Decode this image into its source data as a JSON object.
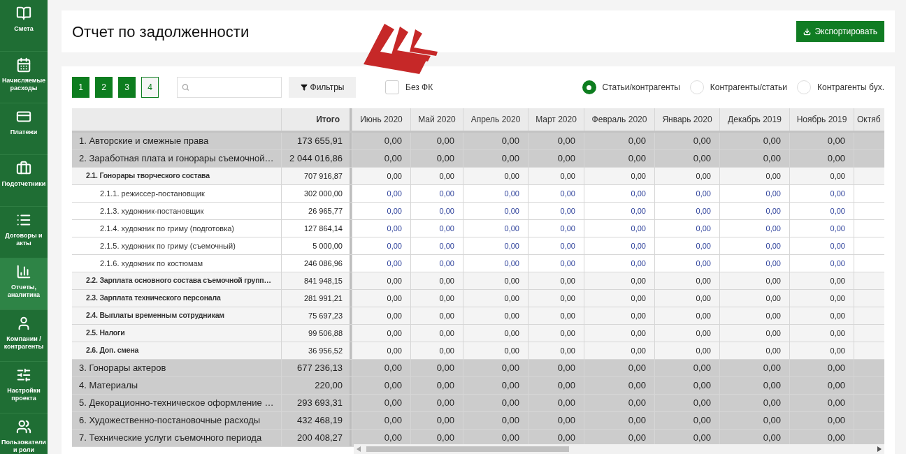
{
  "sidebar": {
    "items": [
      {
        "label": "Смета",
        "selected": false
      },
      {
        "label": "Начисляемые расходы",
        "selected": false
      },
      {
        "label": "Платежи",
        "selected": false
      },
      {
        "label": "Подотчетники",
        "selected": false
      },
      {
        "label": "Договоры и акты",
        "selected": false
      },
      {
        "label": "Отчеты, аналитика",
        "selected": true
      },
      {
        "label": "Компании / контрагенты",
        "selected": false
      },
      {
        "label": "Настройки проекта",
        "selected": false
      },
      {
        "label": "Пользователи и роли",
        "selected": false
      }
    ]
  },
  "header": {
    "title": "Отчет по задолженности",
    "export_button": "Экспортировать"
  },
  "toolbar": {
    "levels": [
      {
        "label": "1",
        "filled": true
      },
      {
        "label": "2",
        "filled": true
      },
      {
        "label": "3",
        "filled": true
      },
      {
        "label": "4",
        "filled": false
      }
    ],
    "filters_button": "Фильтры",
    "checkbox": {
      "label": "Без ФК",
      "checked": false
    },
    "views": [
      {
        "label": "Статьи/контрагенты",
        "selected": true
      },
      {
        "label": "Контрагенты/статьи",
        "selected": false
      },
      {
        "label": "Контрагенты бух.",
        "selected": false
      }
    ]
  },
  "table": {
    "columns": [
      "Итого",
      "Июнь 2020",
      "Май 2020",
      "Апрель 2020",
      "Март 2020",
      "Февраль 2020",
      "Январь 2020",
      "Декабрь 2019",
      "Ноябрь 2019",
      "Октяб"
    ],
    "rows": [
      {
        "label": "1. Авторские и смежные права",
        "total": "173 655,91",
        "values": [
          "0,00",
          "0,00",
          "0,00",
          "0,00",
          "0,00",
          "0,00",
          "0,00",
          "0,00"
        ]
      },
      {
        "label": "2. Заработная плата и гонорары съемочной…",
        "total": "2 044 016,86",
        "values": [
          "0,00",
          "0,00",
          "0,00",
          "0,00",
          "0,00",
          "0,00",
          "0,00",
          "0,00"
        ],
        "children": [
          {
            "label": "2.1. Гонорары творческого состава",
            "total": "707 916,87",
            "values": [
              "0,00",
              "0,00",
              "0,00",
              "0,00",
              "0,00",
              "0,00",
              "0,00",
              "0,00"
            ],
            "children": [
              {
                "label": "2.1.1. режиссер-постановщик",
                "total": "302 000,00",
                "values": [
                  "0,00",
                  "0,00",
                  "0,00",
                  "0,00",
                  "0,00",
                  "0,00",
                  "0,00",
                  "0,00"
                ]
              },
              {
                "label": "2.1.3. художник-постановщик",
                "total": "26 965,77",
                "values": [
                  "0,00",
                  "0,00",
                  "0,00",
                  "0,00",
                  "0,00",
                  "0,00",
                  "0,00",
                  "0,00"
                ]
              },
              {
                "label": "2.1.4. художник по гриму (подготовка)",
                "total": "127 864,14",
                "values": [
                  "0,00",
                  "0,00",
                  "0,00",
                  "0,00",
                  "0,00",
                  "0,00",
                  "0,00",
                  "0,00"
                ]
              },
              {
                "label": "2.1.5. художник по гриму (съемочный)",
                "total": "5 000,00",
                "values": [
                  "0,00",
                  "0,00",
                  "0,00",
                  "0,00",
                  "0,00",
                  "0,00",
                  "0,00",
                  "0,00"
                ]
              },
              {
                "label": "2.1.6. художник по костюмам",
                "total": "246 086,96",
                "values": [
                  "0,00",
                  "0,00",
                  "0,00",
                  "0,00",
                  "0,00",
                  "0,00",
                  "0,00",
                  "0,00"
                ]
              }
            ]
          },
          {
            "label": "2.2. Зарплата основного состава съемочной групп…",
            "total": "841 948,15",
            "values": [
              "0,00",
              "0,00",
              "0,00",
              "0,00",
              "0,00",
              "0,00",
              "0,00",
              "0,00"
            ]
          },
          {
            "label": "2.3. Зарплата технического персонала",
            "total": "281 991,21",
            "values": [
              "0,00",
              "0,00",
              "0,00",
              "0,00",
              "0,00",
              "0,00",
              "0,00",
              "0,00"
            ]
          },
          {
            "label": "2.4. Выплаты временным сотрудникам",
            "total": "75 697,23",
            "values": [
              "0,00",
              "0,00",
              "0,00",
              "0,00",
              "0,00",
              "0,00",
              "0,00",
              "0,00"
            ]
          },
          {
            "label": "2.5. Налоги",
            "total": "99 506,88",
            "values": [
              "0,00",
              "0,00",
              "0,00",
              "0,00",
              "0,00",
              "0,00",
              "0,00",
              "0,00"
            ]
          },
          {
            "label": "2.6. Доп. смена",
            "total": "36 956,52",
            "values": [
              "0,00",
              "0,00",
              "0,00",
              "0,00",
              "0,00",
              "0,00",
              "0,00",
              "0,00"
            ]
          }
        ]
      },
      {
        "label": "3. Гонорары актеров",
        "total": "677 236,13",
        "values": [
          "0,00",
          "0,00",
          "0,00",
          "0,00",
          "0,00",
          "0,00",
          "0,00",
          "0,00"
        ]
      },
      {
        "label": "4. Материалы",
        "total": "220,00",
        "values": [
          "0,00",
          "0,00",
          "0,00",
          "0,00",
          "0,00",
          "0,00",
          "0,00",
          "0,00"
        ]
      },
      {
        "label": "5. Декорационно-техническое оформление …",
        "total": "293 693,31",
        "values": [
          "0,00",
          "0,00",
          "0,00",
          "0,00",
          "0,00",
          "0,00",
          "0,00",
          "0,00"
        ]
      },
      {
        "label": "6. Художественно-постановочные расходы",
        "total": "432 468,19",
        "values": [
          "0,00",
          "0,00",
          "0,00",
          "0,00",
          "0,00",
          "0,00",
          "0,00",
          "0,00"
        ]
      },
      {
        "label": "7. Технические услуги съемочного периода",
        "total": "200 408,27",
        "values": [
          "0,00",
          "0,00",
          "0,00",
          "0,00",
          "0,00",
          "0,00",
          "0,00",
          "0,00"
        ]
      }
    ]
  }
}
